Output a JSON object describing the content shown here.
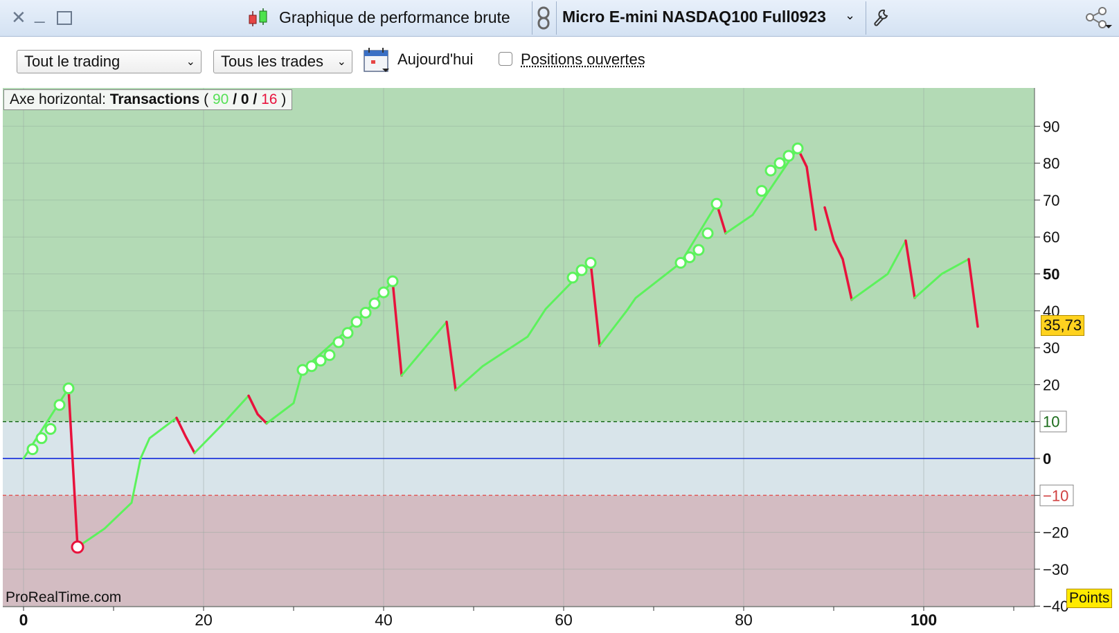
{
  "titlebar": {
    "title": "Graphique de performance brute",
    "instrument": "Micro E-mini NASDAQ100 Full0923",
    "icons": [
      "close-icon",
      "minimize-icon",
      "maximize-icon",
      "candlestick-icon",
      "link-icon",
      "chevron-down-icon",
      "wrench-icon",
      "share-icon"
    ]
  },
  "toolbar": {
    "period_select": "Tout le trading",
    "trades_select": "Tous les trades",
    "today_label": "Aujourd'hui",
    "open_positions_label": "Positions ouvertes",
    "open_positions_checked": false
  },
  "axis_info": {
    "prefix": "Axe horizontal:",
    "mode": "Transactions",
    "wins": "90",
    "neutral": "0",
    "losses": "16"
  },
  "brand": "ProRealTime.com",
  "current_value_label": "35,73",
  "unit_label": "Points",
  "colors": {
    "win_line": "#5cf25c",
    "loss_line": "#e8123c",
    "zero_line": "#0018d9",
    "upper_threshold": "#1a6b1a",
    "lower_threshold": "#e05a5a",
    "zone_top": "#b3dab5",
    "zone_mid": "#d8e4ea",
    "zone_bottom": "#d3bcc2",
    "price_tag": "#ffd21f"
  },
  "chart_data": {
    "type": "line",
    "xlabel": "",
    "ylabel": "",
    "xlim": [
      -2,
      112
    ],
    "ylim": [
      -40,
      100
    ],
    "x_ticks": [
      0,
      20,
      40,
      60,
      80,
      100
    ],
    "y_ticks": [
      -40,
      -30,
      -20,
      -10,
      0,
      10,
      20,
      30,
      40,
      50,
      60,
      70,
      80,
      90
    ],
    "thresholds": [
      10,
      0,
      -10
    ],
    "grid": true,
    "current_value": 35.73,
    "segments": [
      {
        "x": [
          0,
          5
        ],
        "y": [
          0,
          19
        ],
        "result": "win"
      },
      {
        "x": [
          5,
          6
        ],
        "y": [
          19,
          -24
        ],
        "result": "loss"
      },
      {
        "x": [
          6,
          9,
          12,
          13,
          14,
          17
        ],
        "y": [
          -24,
          -19,
          -12,
          0,
          5.5,
          11
        ],
        "result": "win"
      },
      {
        "x": [
          17,
          18,
          19
        ],
        "y": [
          11,
          6,
          1.5
        ],
        "result": "loss"
      },
      {
        "x": [
          19,
          22,
          25
        ],
        "y": [
          1.5,
          9,
          17
        ],
        "result": "win"
      },
      {
        "x": [
          25,
          26,
          27
        ],
        "y": [
          17,
          12,
          9.5
        ],
        "result": "loss"
      },
      {
        "x": [
          27,
          30,
          31,
          37,
          41
        ],
        "y": [
          9.5,
          15,
          24,
          37,
          48
        ],
        "result": "win"
      },
      {
        "x": [
          41,
          42
        ],
        "y": [
          48,
          22.5
        ],
        "result": "loss"
      },
      {
        "x": [
          42,
          47
        ],
        "y": [
          22.5,
          37
        ],
        "result": "win"
      },
      {
        "x": [
          47,
          48
        ],
        "y": [
          37,
          18.5
        ],
        "result": "loss"
      },
      {
        "x": [
          48,
          51,
          56,
          58,
          63
        ],
        "y": [
          18.5,
          25,
          33,
          40.5,
          53
        ],
        "result": "win"
      },
      {
        "x": [
          63,
          64
        ],
        "y": [
          53,
          30.5
        ],
        "result": "loss"
      },
      {
        "x": [
          64,
          67,
          68,
          73,
          77
        ],
        "y": [
          30.5,
          40,
          43.5,
          53,
          69
        ],
        "result": "win"
      },
      {
        "x": [
          77,
          78
        ],
        "y": [
          69,
          61
        ],
        "result": "loss"
      },
      {
        "x": [
          78,
          81,
          86
        ],
        "y": [
          61,
          66,
          84
        ],
        "result": "win"
      },
      {
        "x": [
          86,
          87,
          88
        ],
        "y": [
          84,
          79,
          62
        ],
        "result": "loss"
      },
      {
        "x": [
          89,
          90,
          91,
          92
        ],
        "y": [
          68,
          59,
          54,
          43
        ],
        "result": "loss"
      },
      {
        "x": [
          92,
          96,
          98
        ],
        "y": [
          43,
          50,
          59
        ],
        "result": "win"
      },
      {
        "x": [
          98,
          99
        ],
        "y": [
          59,
          43.5
        ],
        "result": "loss"
      },
      {
        "x": [
          99,
          102,
          105
        ],
        "y": [
          43.5,
          50,
          54
        ],
        "result": "win"
      },
      {
        "x": [
          105,
          106
        ],
        "y": [
          54,
          35.73
        ],
        "result": "loss"
      }
    ],
    "markers": [
      {
        "x": 1,
        "y": 2.5,
        "result": "win"
      },
      {
        "x": 2,
        "y": 5.5,
        "result": "win"
      },
      {
        "x": 3,
        "y": 8,
        "result": "win"
      },
      {
        "x": 4,
        "y": 14.5,
        "result": "win"
      },
      {
        "x": 5,
        "y": 19,
        "result": "win"
      },
      {
        "x": 6,
        "y": -24,
        "result": "loss"
      },
      {
        "x": 31,
        "y": 24,
        "result": "win"
      },
      {
        "x": 32,
        "y": 25,
        "result": "win"
      },
      {
        "x": 33,
        "y": 26.5,
        "result": "win"
      },
      {
        "x": 34,
        "y": 28,
        "result": "win"
      },
      {
        "x": 35,
        "y": 31.5,
        "result": "win"
      },
      {
        "x": 36,
        "y": 34,
        "result": "win"
      },
      {
        "x": 37,
        "y": 37,
        "result": "win"
      },
      {
        "x": 38,
        "y": 39.5,
        "result": "win"
      },
      {
        "x": 39,
        "y": 42,
        "result": "win"
      },
      {
        "x": 40,
        "y": 45,
        "result": "win"
      },
      {
        "x": 41,
        "y": 48,
        "result": "win"
      },
      {
        "x": 61,
        "y": 49,
        "result": "win"
      },
      {
        "x": 62,
        "y": 51,
        "result": "win"
      },
      {
        "x": 63,
        "y": 53,
        "result": "win"
      },
      {
        "x": 73,
        "y": 53,
        "result": "win"
      },
      {
        "x": 74,
        "y": 54.5,
        "result": "win"
      },
      {
        "x": 75,
        "y": 56.5,
        "result": "win"
      },
      {
        "x": 76,
        "y": 61,
        "result": "win"
      },
      {
        "x": 77,
        "y": 69,
        "result": "win"
      },
      {
        "x": 82,
        "y": 72.5,
        "result": "win"
      },
      {
        "x": 83,
        "y": 78,
        "result": "win"
      },
      {
        "x": 84,
        "y": 80,
        "result": "win"
      },
      {
        "x": 85,
        "y": 82,
        "result": "win"
      },
      {
        "x": 86,
        "y": 84,
        "result": "win"
      }
    ]
  }
}
